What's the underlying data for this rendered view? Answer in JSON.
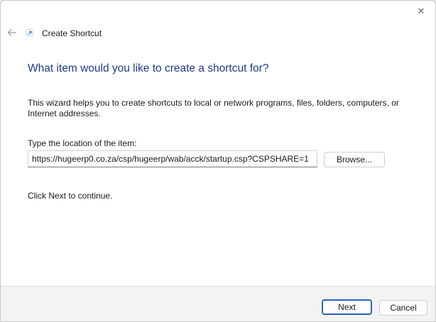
{
  "window": {
    "close_glyph": "✕"
  },
  "header": {
    "title": "Create Shortcut"
  },
  "main": {
    "heading": "What item would you like to create a shortcut for?",
    "description": "This wizard helps you to create shortcuts to local or network programs, files, folders, computers, or Internet addresses.",
    "location_label": "Type the location of the item:",
    "location_value": "https://hugeerp0.co.za/csp/hugeerp/wab/acck/startup.csp?CSPSHARE=1",
    "browse_label": "Browse...",
    "continue_text": "Click Next to continue."
  },
  "footer": {
    "next_label": "Next",
    "cancel_label": "Cancel"
  },
  "colors": {
    "heading": "#1f3b8c",
    "default_button_border": "#2b63b8",
    "shortcut_arrow": "#2f6fd6"
  },
  "icons": {
    "back": "arrow-left-icon",
    "shortcut": "shortcut-arrow-icon",
    "close": "close-icon"
  }
}
